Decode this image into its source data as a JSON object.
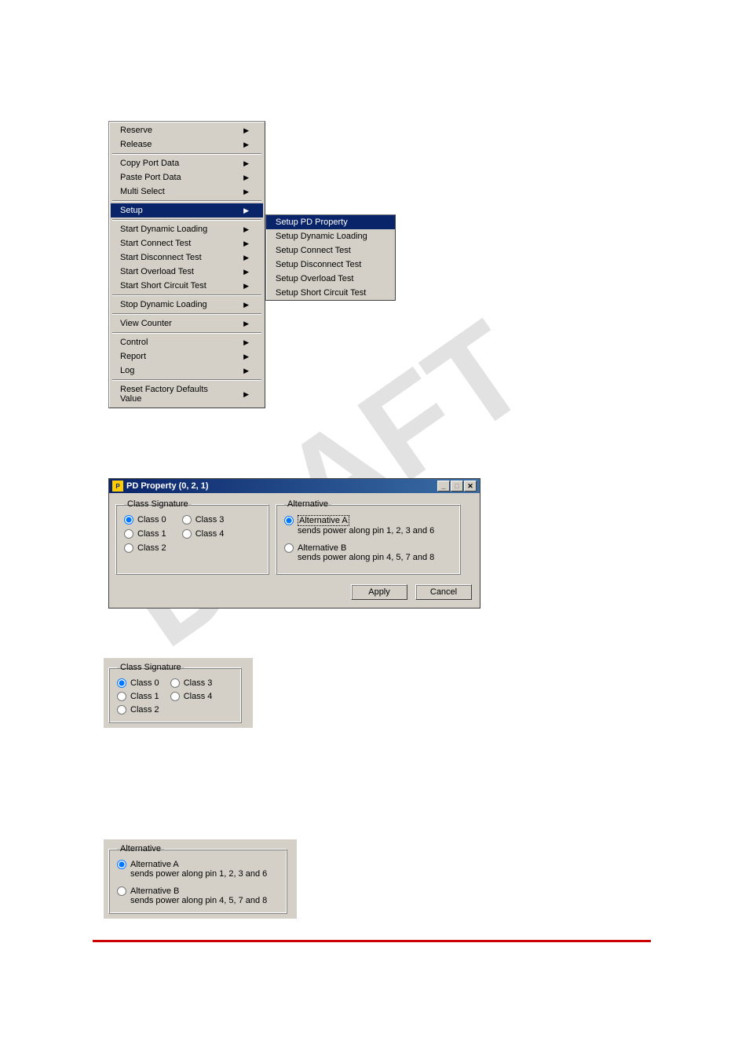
{
  "menu": {
    "groups": [
      [
        "Reserve",
        "Release"
      ],
      [
        "Copy Port Data",
        "Paste Port Data",
        "Multi Select"
      ],
      [
        "Setup"
      ],
      [
        "Start Dynamic Loading",
        "Start Connect Test",
        "Start Disconnect Test",
        "Start Overload Test",
        "Start Short Circuit Test"
      ],
      [
        "Stop Dynamic Loading"
      ],
      [
        "View Counter"
      ],
      [
        "Control",
        "Report",
        "Log"
      ],
      [
        "Reset Factory Defaults Value"
      ]
    ],
    "highlighted": "Setup"
  },
  "submenu": {
    "items": [
      "Setup PD Property",
      "Setup Dynamic Loading",
      "Setup Connect Test",
      "Setup Disconnect Test",
      "Setup Overload Test",
      "Setup Short Circuit Test"
    ],
    "highlighted": "Setup PD Property"
  },
  "dialog": {
    "title": "PD Property (0, 2, 1)",
    "class_signature": {
      "legend": "Class Signature",
      "col1": [
        "Class 0",
        "Class 1",
        "Class 2"
      ],
      "col2": [
        "Class 3",
        "Class 4"
      ],
      "selected": "Class 0"
    },
    "alternative": {
      "legend": "Alternative",
      "optA": {
        "label": "Alternative A",
        "desc": "sends power along pin 1, 2, 3 and 6"
      },
      "optB": {
        "label": "Alternative B",
        "desc": "sends power along pin 4, 5, 7 and 8"
      },
      "selected": "Alternative A"
    },
    "buttons": {
      "apply": "Apply",
      "cancel": "Cancel"
    }
  },
  "standalone_class": {
    "legend": "Class Signature",
    "col1": [
      "Class 0",
      "Class 1",
      "Class 2"
    ],
    "col2": [
      "Class 3",
      "Class 4"
    ],
    "selected": "Class 0"
  },
  "standalone_alt": {
    "legend": "Alternative",
    "optA": {
      "label": "Alternative A",
      "desc": "sends power along pin 1, 2, 3 and 6"
    },
    "optB": {
      "label": "Alternative B",
      "desc": "sends power along pin 4, 5, 7 and 8"
    },
    "selected": "Alternative A"
  }
}
